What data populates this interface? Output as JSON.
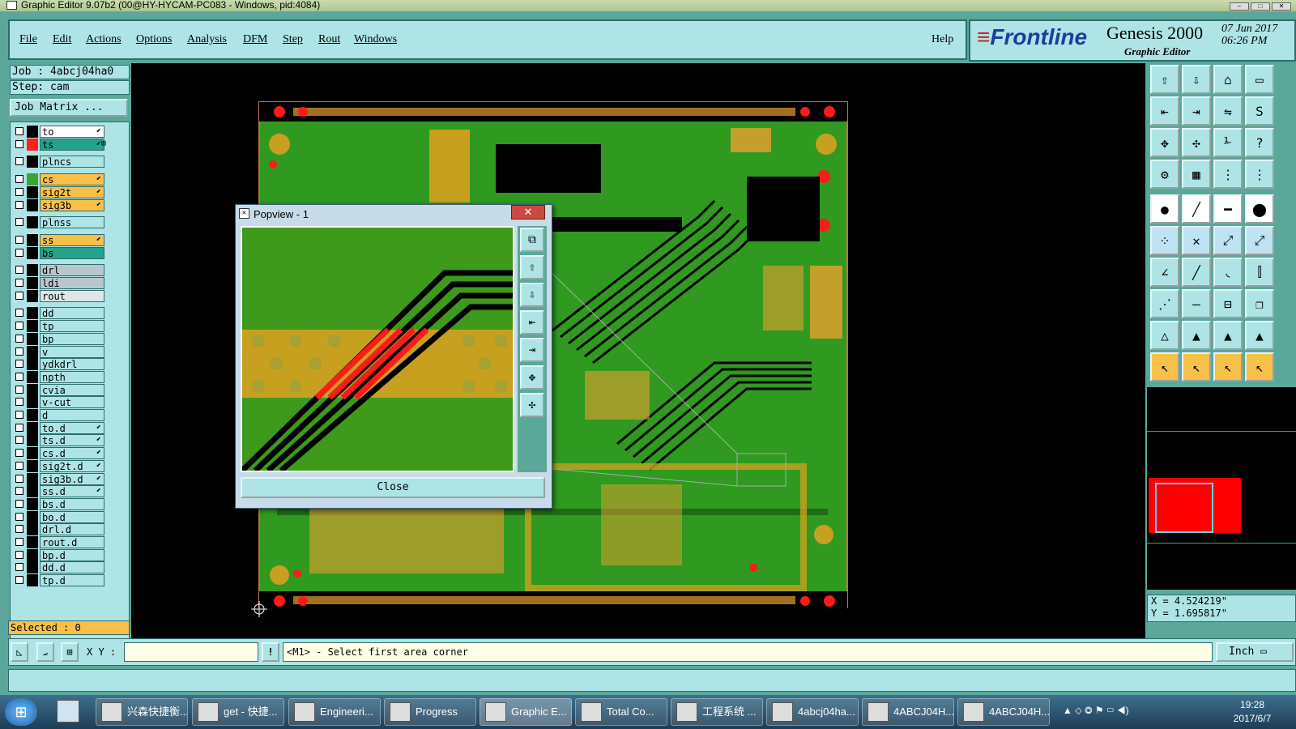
{
  "window": {
    "title": "Graphic Editor 9.07b2 (00@HY-HYCAM-PC083 - Windows, pid:4084)"
  },
  "menu": [
    "File",
    "Edit",
    "Actions",
    "Options",
    "Analysis",
    "DFM",
    "Step",
    "Rout",
    "Windows"
  ],
  "help": "Help",
  "brand": {
    "logo": "Frontline",
    "product": "Genesis 2000",
    "subtitle": "Graphic Editor",
    "date": "07 Jun 2017",
    "time": "06:26 PM"
  },
  "job": {
    "job_label": "Job : 4abcj04ha0",
    "step_label": "Step: cam",
    "matrix_button": "Job Matrix ..."
  },
  "layers": [
    {
      "name": "to",
      "color": "#ffffff",
      "sw": "#000000",
      "edit": "⬋"
    },
    {
      "name": "ts",
      "color": "#22a38a",
      "sw": "#ff2020",
      "edit": "⬋⊞"
    },
    {
      "name": "plncs",
      "color": "#aee4e6",
      "sw": "#000000",
      "edit": ""
    },
    {
      "name": "cs",
      "color": "#f9c048",
      "sw": "#3aa535",
      "edit": "⬋"
    },
    {
      "name": "sig2t",
      "color": "#f9c048",
      "sw": "#000000",
      "edit": "⬋"
    },
    {
      "name": "sig3b",
      "color": "#f9c048",
      "sw": "#000000",
      "edit": "⬋"
    },
    {
      "name": "plnss",
      "color": "#aee4e6",
      "sw": "#000000",
      "edit": ""
    },
    {
      "name": "ss",
      "color": "#f9c048",
      "sw": "#000000",
      "edit": "⬋"
    },
    {
      "name": "bs",
      "color": "#22a38a",
      "sw": "#000000",
      "edit": ""
    },
    {
      "name": "drl",
      "color": "#b9c6cc",
      "sw": "#000000",
      "edit": ""
    },
    {
      "name": "ldi",
      "color": "#b9c6cc",
      "sw": "#000000",
      "edit": ""
    },
    {
      "name": "rout",
      "color": "#dfe6e8",
      "sw": "#000000",
      "edit": ""
    },
    {
      "name": "dd",
      "color": "#aee4e6",
      "sw": "#000000",
      "edit": ""
    },
    {
      "name": "tp",
      "color": "#aee4e6",
      "sw": "#000000",
      "edit": ""
    },
    {
      "name": "bp",
      "color": "#aee4e6",
      "sw": "#000000",
      "edit": ""
    },
    {
      "name": "v",
      "color": "#aee4e6",
      "sw": "#000000",
      "edit": ""
    },
    {
      "name": "ydkdrl",
      "color": "#aee4e6",
      "sw": "#000000",
      "edit": ""
    },
    {
      "name": "npth",
      "color": "#aee4e6",
      "sw": "#000000",
      "edit": ""
    },
    {
      "name": "cvia",
      "color": "#aee4e6",
      "sw": "#000000",
      "edit": ""
    },
    {
      "name": "v-cut",
      "color": "#aee4e6",
      "sw": "#000000",
      "edit": ""
    },
    {
      "name": "d",
      "color": "#aee4e6",
      "sw": "#000000",
      "edit": ""
    },
    {
      "name": "to.d",
      "color": "#aee4e6",
      "sw": "#000000",
      "edit": "⬋"
    },
    {
      "name": "ts.d",
      "color": "#aee4e6",
      "sw": "#000000",
      "edit": "⬋"
    },
    {
      "name": "cs.d",
      "color": "#aee4e6",
      "sw": "#000000",
      "edit": "⬋"
    },
    {
      "name": "sig2t.d",
      "color": "#aee4e6",
      "sw": "#000000",
      "edit": "⬋"
    },
    {
      "name": "sig3b.d",
      "color": "#aee4e6",
      "sw": "#000000",
      "edit": "⬋"
    },
    {
      "name": "ss.d",
      "color": "#aee4e6",
      "sw": "#000000",
      "edit": "⬋"
    },
    {
      "name": "bs.d",
      "color": "#aee4e6",
      "sw": "#000000",
      "edit": ""
    },
    {
      "name": "bo.d",
      "color": "#aee4e6",
      "sw": "#000000",
      "edit": ""
    },
    {
      "name": "drl.d",
      "color": "#aee4e6",
      "sw": "#000000",
      "edit": ""
    },
    {
      "name": "rout.d",
      "color": "#aee4e6",
      "sw": "#000000",
      "edit": ""
    },
    {
      "name": "bp.d",
      "color": "#aee4e6",
      "sw": "#000000",
      "edit": ""
    },
    {
      "name": "dd.d",
      "color": "#aee4e6",
      "sw": "#000000",
      "edit": ""
    },
    {
      "name": "tp.d",
      "color": "#aee4e6",
      "sw": "#000000",
      "edit": ""
    }
  ],
  "selected": "Selected : 0",
  "coords": {
    "x": "X = 4.524219\"",
    "y": "Y = 1.695817\""
  },
  "status": {
    "xy_label": "X Y :",
    "xy_value": "",
    "message": "<M1> - Select first area corner",
    "units": "Inch"
  },
  "popview": {
    "title": "Popview - 1",
    "close_x": "✕",
    "close_button": "Close"
  },
  "taskbar": {
    "items": [
      "兴森快捷衡...",
      "get - 快捷...",
      "Engineeri...",
      "Progress",
      "Graphic E...",
      "Total Co...",
      "工程系统 ...",
      "4abcj04ha...",
      "4ABCJ04H...",
      "4ABCJ04H..."
    ],
    "time": "19:28",
    "date": "2017/6/7"
  }
}
